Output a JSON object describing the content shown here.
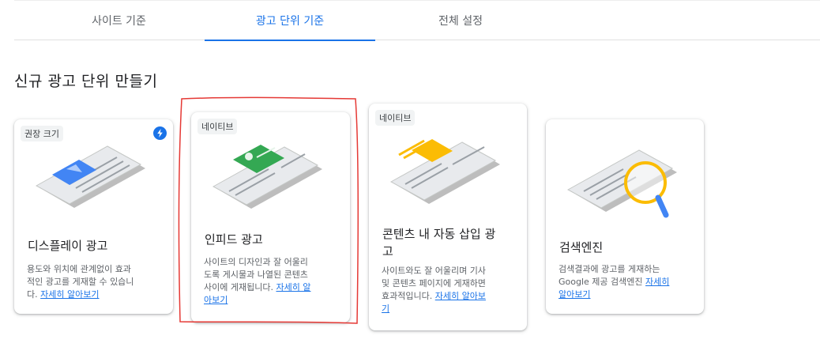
{
  "tabs": [
    {
      "label": "사이트 기준",
      "active": false
    },
    {
      "label": "광고 단위 기준",
      "active": true
    },
    {
      "label": "전체 설정",
      "active": false
    }
  ],
  "section_title": "신규 광고 단위 만들기",
  "cards": [
    {
      "badge": "권장 크기",
      "title": "디스플레이 광고",
      "desc_lines": [
        "용도와 위치에 관계없이 효과",
        "적인 광고를 게재할 수 있습니",
        "다. "
      ],
      "link_text": "자세히 알아보기",
      "accent": "#4285f4"
    },
    {
      "badge": "네이티브",
      "title": "인피드 광고",
      "desc_lines": [
        "사이트의 디자인과 잘 어울리",
        "도록 게시물과 나열된 콘텐츠",
        "사이에 게재됩니다. "
      ],
      "link_text_1": "자세히 알",
      "link_text_2": "아보기",
      "accent": "#34a853"
    },
    {
      "badge": "네이티브",
      "title_lines": [
        "콘텐츠 내 자동 삽입 광",
        "고"
      ],
      "desc_lines": [
        "사이트와도 잘 어울리며 기사",
        "및 콘텐츠 페이지에 게재하면",
        "효과적입니다. "
      ],
      "link_text_1": "자세히 알아보",
      "link_text_2": "기",
      "accent": "#fbbc04"
    },
    {
      "title": "검색엔진",
      "desc_lines": [
        "검색결과에 광고를 게재하는",
        "Google 제공 검색엔진 "
      ],
      "link_text_1": "자세히",
      "link_text_2": "알아보기",
      "accent": "#fbbc04"
    }
  ],
  "colors": {
    "primary": "#1a73e8",
    "highlight": "#e53935"
  }
}
